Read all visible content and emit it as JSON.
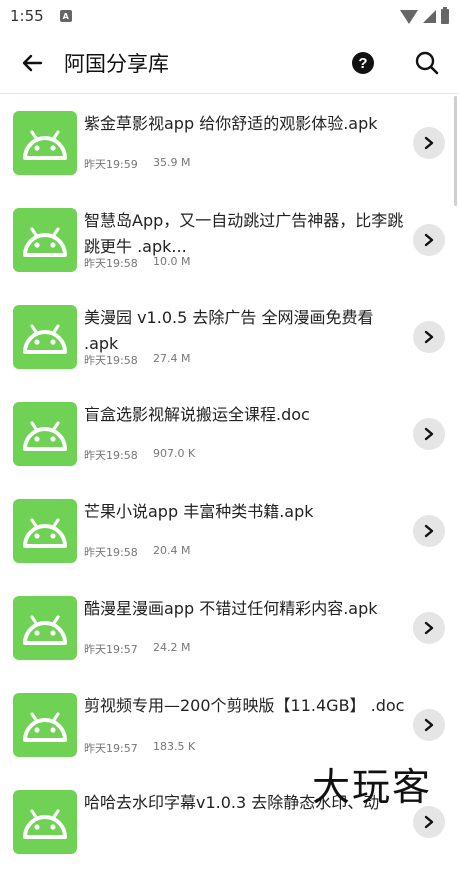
{
  "status_bar": {
    "time": "1:55",
    "notification_letter": "A"
  },
  "app_bar": {
    "title": "阿国分享库",
    "help_glyph": "?"
  },
  "items": [
    {
      "name": "紫金草影视app 给你舒适的观影体验.apk",
      "time": "昨天19:59",
      "size": "35.9 M"
    },
    {
      "name": "智慧岛App，又一自动跳过广告神器，比李跳跳更牛 .apk...",
      "time": "昨天19:58",
      "size": "10.0 M"
    },
    {
      "name": "美漫园 v1.0.5 去除广告 全网漫画免费看 .apk",
      "time": "昨天19:58",
      "size": "27.4 M"
    },
    {
      "name": "盲盒选影视解说搬运全课程.doc",
      "time": "昨天19:58",
      "size": "907.0 K"
    },
    {
      "name": "芒果小说app 丰富种类书籍.apk",
      "time": "昨天19:58",
      "size": "20.4 M"
    },
    {
      "name": "酷漫星漫画app 不错过任何精彩内容.apk",
      "time": "昨天19:57",
      "size": "24.2 M"
    },
    {
      "name": "剪视频专用—200个剪映版【11.4GB】 .doc",
      "time": "昨天19:57",
      "size": "183.5 K"
    },
    {
      "name": "哈哈去水印字幕v1.0.3 去除静态水印、动",
      "time": "",
      "size": ""
    }
  ],
  "watermark": "大玩客"
}
